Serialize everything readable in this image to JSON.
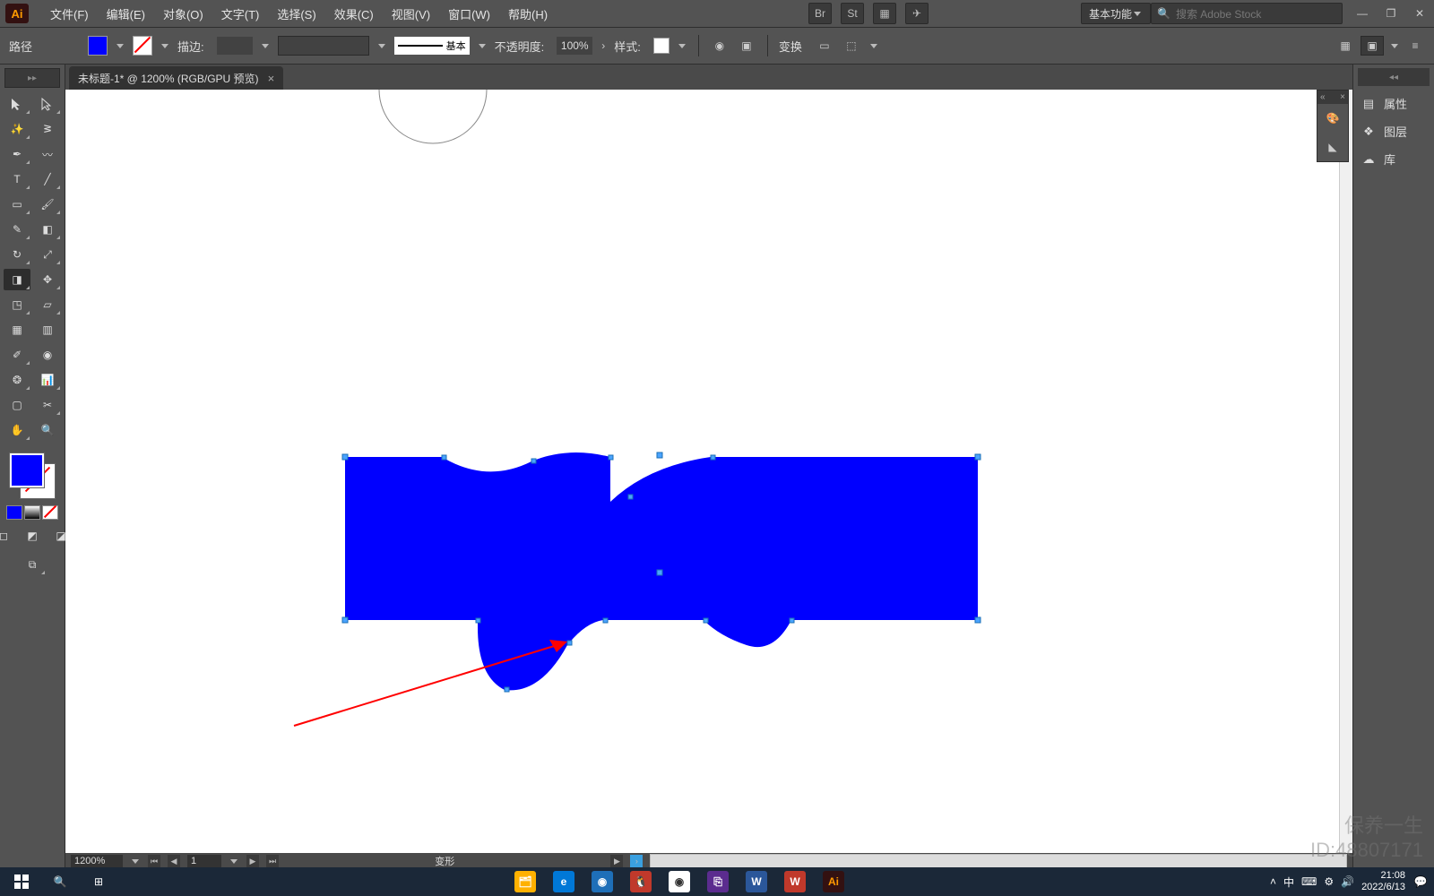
{
  "app": {
    "logo": "Ai"
  },
  "menu": {
    "file": "文件(F)",
    "edit": "编辑(E)",
    "object": "对象(O)",
    "type": "文字(T)",
    "select": "选择(S)",
    "effect": "效果(C)",
    "view": "视图(V)",
    "window": "窗口(W)",
    "help": "帮助(H)"
  },
  "workspace": {
    "name": "基本功能"
  },
  "search": {
    "placeholder": "搜索 Adobe Stock"
  },
  "control_bar": {
    "path_label": "路径",
    "fill_color": "#0000ff",
    "stroke_label": "描边:",
    "line_preview_label": "基本",
    "opacity_label": "不透明度:",
    "opacity_value": "100%",
    "style_label": "样式:",
    "transform_btn": "变换"
  },
  "document": {
    "tab_title": "未标题-1* @ 1200% (RGB/GPU 预览)"
  },
  "status_bar": {
    "zoom": "1200%",
    "artboard_index": "1",
    "mode": "变形"
  },
  "right_panel": {
    "properties": "属性",
    "layers": "图层",
    "libraries": "库"
  },
  "taskbar": {
    "time": "21:08",
    "date": "2022/6/13",
    "ime_lang": "中"
  },
  "watermark": {
    "line1": "保养一生",
    "line2": "ID:48807171"
  }
}
